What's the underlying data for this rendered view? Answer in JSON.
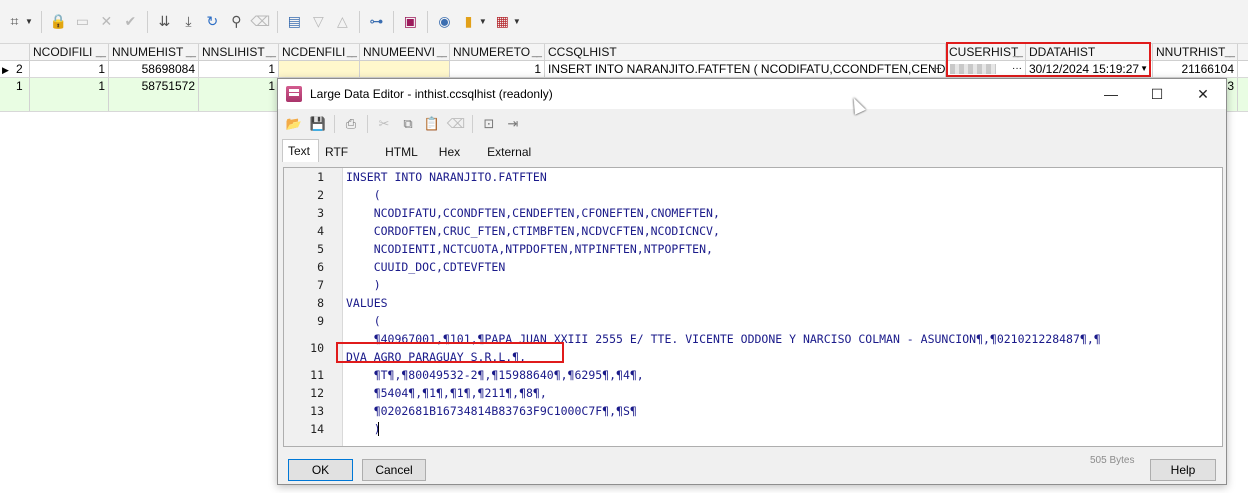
{
  "toolbar": {
    "icons": [
      "grid-options-icon",
      "lock-icon",
      "new-record-icon",
      "cancel-edit-icon",
      "post-check-icon",
      "sort-desc-icon",
      "sort-desc-all-icon",
      "refresh-icon",
      "find-icon",
      "clear-icon",
      "layout-icon",
      "filter-down-icon",
      "filter-up-icon",
      "diagram-icon",
      "save-icon",
      "query-icon",
      "chart-icon",
      "table-icon"
    ]
  },
  "grid": {
    "columns": [
      "NCODIFILI",
      "NNUMEHIST",
      "NNSLIHIST",
      "NCDENFILI",
      "NNUMEENVI",
      "NNUMERETO",
      "CCSQLHIST",
      "CUSERHIST",
      "DDATAHIST",
      "NNUTRHIST"
    ],
    "rows": [
      {
        "indicator": "▶",
        "row_num": "2",
        "ncodifili": "1",
        "nnumehist": "58698084",
        "nnslihist": "1",
        "ncdenfili": "",
        "nnumeenvi": "",
        "nnumereto": "1",
        "ccsqlhist": "INSERT INTO NARANJITO.FATFTEN   (    NCODIFATU,CCONDFTEN,CENDEFTEN,CF",
        "ddatahist": "30/12/2024 15:19:27",
        "nnutrhist": "21166104"
      },
      {
        "indicator": "",
        "row_num": "1",
        "ncodifili": "1",
        "nnumehist": "58751572",
        "nnslihist": "1",
        "nnutrhist": "3"
      }
    ]
  },
  "dialog": {
    "title": "Large Data Editor - inthist.ccsqlhist (readonly)",
    "tabs": [
      "Text",
      "RTF",
      "HTML",
      "Hex",
      "External"
    ],
    "active_tab": "Text",
    "lines": [
      {
        "n": "1",
        "text": "INSERT INTO NARANJITO.FATFTEN"
      },
      {
        "n": "2",
        "text": "    ("
      },
      {
        "n": "3",
        "text": "    NCODIFATU,CCONDFTEN,CENDEFTEN,CFONEFTEN,CNOMEFTEN,"
      },
      {
        "n": "4",
        "text": "    CORDOFTEN,CRUC_FTEN,CTIMBFTEN,NCDVCFTEN,NCODICNCV,"
      },
      {
        "n": "5",
        "text": "    NCODIENTI,NCTCUOTA,NTPDOFTEN,NTPINFTEN,NTPOPFTEN,"
      },
      {
        "n": "6",
        "text": "    CUUID_DOC,CDTEVFTEN"
      },
      {
        "n": "7",
        "text": "    )"
      },
      {
        "n": "8",
        "text": "VALUES"
      },
      {
        "n": "9",
        "text": "    ("
      },
      {
        "n": "10",
        "text": "    ¶40967001,¶101,¶PAPA JUAN XXIII 2555 E/ TTE. VICENTE ODDONE Y NARCISO COLMAN - ASUNCION¶,¶021021228487¶,¶"
      },
      {
        "n": "",
        "text": "DVA AGRO PARAGUAY S.R.L.¶,"
      },
      {
        "n": "11",
        "text": "    ¶T¶,¶80049532-2¶,¶15988640¶,¶6295¶,¶4¶,"
      },
      {
        "n": "12",
        "text": "    ¶5404¶,¶1¶,¶1¶,¶211¶,¶8¶,"
      },
      {
        "n": "13",
        "text": "    ¶0202681B16734814B83763F9C1000C7F¶,¶S¶"
      },
      {
        "n": "14",
        "text": "    )"
      }
    ],
    "ok_label": "OK",
    "cancel_label": "Cancel",
    "help_label": "Help",
    "size_label": "505 Bytes"
  },
  "colors": {
    "highlight": "#e01b1b",
    "code_text": "#1a1a8a",
    "selected_row": "#e9fde3"
  }
}
